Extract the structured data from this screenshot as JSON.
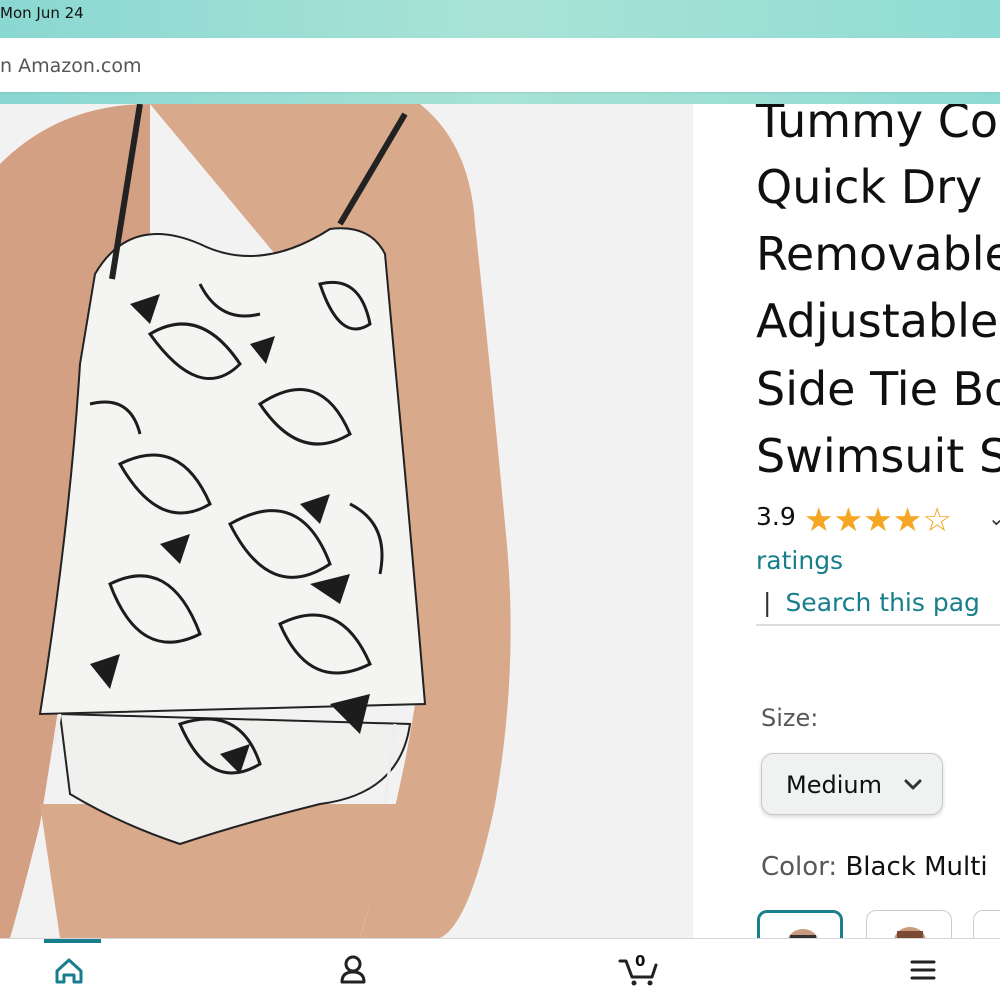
{
  "status_bar": {
    "time": "Mon Jun 24"
  },
  "search": {
    "text": "n Amazon.com"
  },
  "product": {
    "title_lines": [
      "Tummy Co",
      "Quick Dry",
      "Removable",
      "Adjustable",
      "Side Tie Bo",
      "Swimsuit S"
    ],
    "rating": {
      "value": "3.9",
      "stars_filled": 4,
      "stars_total": 5,
      "ratings_link": "ratings"
    },
    "search_this_page": "Search this pag",
    "separator": "|",
    "size": {
      "label": "Size:",
      "selected": "Medium"
    },
    "color": {
      "label": "Color:",
      "selected": "Black Multi"
    }
  },
  "bottom_nav": {
    "items": [
      {
        "name": "home",
        "icon": "home-icon",
        "active": true
      },
      {
        "name": "account",
        "icon": "account-icon"
      },
      {
        "name": "cart",
        "icon": "cart-icon",
        "count": "0"
      },
      {
        "name": "menu",
        "icon": "menu-icon"
      }
    ]
  },
  "colors": {
    "accent_teal": "#177e8c",
    "star": "#f5a623",
    "header_gradient": "#8ad8d2"
  }
}
